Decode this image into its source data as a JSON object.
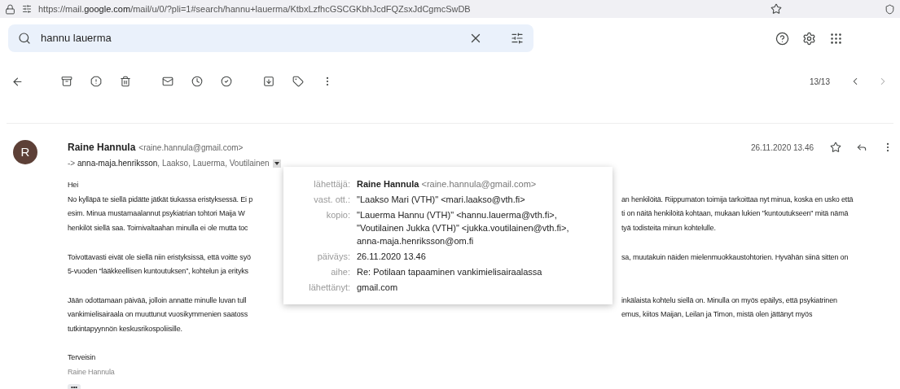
{
  "address_bar": {
    "url": "https://mail.**google.com**/mail/u/0/?pli=1#search/hannu+lauerma/KtbxLzfhcGSCGKbhJcdFQZsxJdCgmcSwDB"
  },
  "search": {
    "value": "hannu lauerma"
  },
  "pager": {
    "count": "13/13"
  },
  "message": {
    "avatar_letter": "R",
    "sender_name": "Raine Hannula",
    "sender_email": "<raine.hannula@gmail.com>",
    "recipients_prefix": "->",
    "recipients_first": "anna-maja.henriksson",
    "recipients_rest": ", Laakso, Lauerma, Voutilainen",
    "date": "26.11.2020 13.46",
    "paragraphs": [
      {
        "lines": [
          {
            "left": "Hei"
          },
          {
            "left": "No kylläpä te siellä pidätte jätkät tiukassa eristyksessä. Ei p",
            "right": "an henkilöitä. Riippumaton toimija tarkoittaa nyt minua, koska en usko että"
          },
          {
            "left": "esim. Minua mustamaalannut psykiatrian tohtori Maija W",
            "right": "ti on näitä henkilöitä kohtaan, mukaan lukien \"kuntoutukseen\" mitä nämä"
          },
          {
            "left": "henkilöt siellä saa. Toimivaltaahan minulla ei ole mutta toc",
            "right": "tyä todisteita minun kohtelulle."
          }
        ]
      },
      {
        "lines": [
          {
            "left": "Toivottavasti eivät ole siellä niin eristyksissä, että voitte syö",
            "right": "sa, muutakuin näiden mielenmuokkaustohtorien. Hyvähän siinä sitten on"
          },
          {
            "left": "5-vuoden “lääkkeellisen kuntoutuksen”, kohtelun ja erityks"
          }
        ]
      },
      {
        "lines": [
          {
            "left": "Jään odottamaan päivää, jolloin annatte minulle luvan tull",
            "right": "inkälaista kohtelu siellä on. Minulla on myös epäilys, että psykiatrinen"
          },
          {
            "left": "vankimielisairaala on muuttunut vuosikymmenien saatoss",
            "right": "emus, kiitos Maijan, Leilan ja Timon, mistä olen jättänyt myös"
          },
          {
            "left": "tutkintapyynnön keskusrikospoliisille."
          }
        ]
      }
    ],
    "signoff": "Terveisin",
    "signature": "Raine Hannula",
    "trimmed_button": "•••"
  },
  "details_popup": {
    "rows": [
      {
        "kind": "sender",
        "label": "lähettäjä:",
        "name": "Raine Hannula",
        "email": "<raine.hannula@gmail.com>"
      },
      {
        "kind": "text",
        "label": "vast. ott.:",
        "lines": [
          "\"Laakso Mari (VTH)\" <mari.laakso@vth.fi>"
        ]
      },
      {
        "kind": "text",
        "label": "kopio:",
        "lines": [
          "\"Lauerma Hannu (VTH)\" <hannu.lauerma@vth.fi>,",
          "\"Voutilainen Jukka (VTH)\" <jukka.voutilainen@vth.fi>,",
          "anna-maja.henriksson@om.fi"
        ]
      },
      {
        "kind": "text",
        "label": "päiväys:",
        "lines": [
          "26.11.2020 13.46"
        ]
      },
      {
        "kind": "text",
        "label": "aihe:",
        "lines": [
          "Re: Potilaan tapaaminen vankimielisairaalassa"
        ]
      },
      {
        "kind": "text",
        "label": "lähettänyt:",
        "lines": [
          "gmail.com"
        ]
      }
    ]
  }
}
